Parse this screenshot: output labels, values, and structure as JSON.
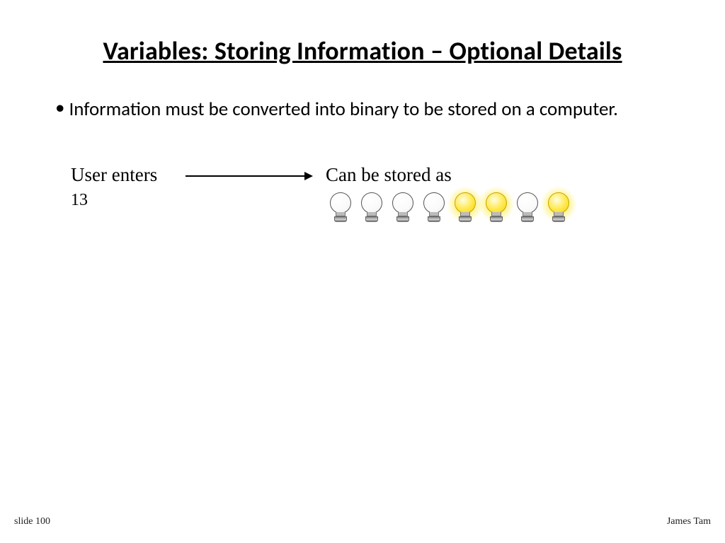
{
  "title": "Variables: Storing Information – Optional Details",
  "bullet": {
    "marker": "•",
    "text": "Information must be converted into binary to be stored on a computer."
  },
  "diagram": {
    "leftLabel": "User enters",
    "leftValue": "13",
    "rightLabel": "Can be stored as",
    "bits": [
      0,
      0,
      0,
      0,
      1,
      1,
      0,
      1
    ]
  },
  "footer": {
    "left": "slide 100",
    "right": "James Tam"
  }
}
